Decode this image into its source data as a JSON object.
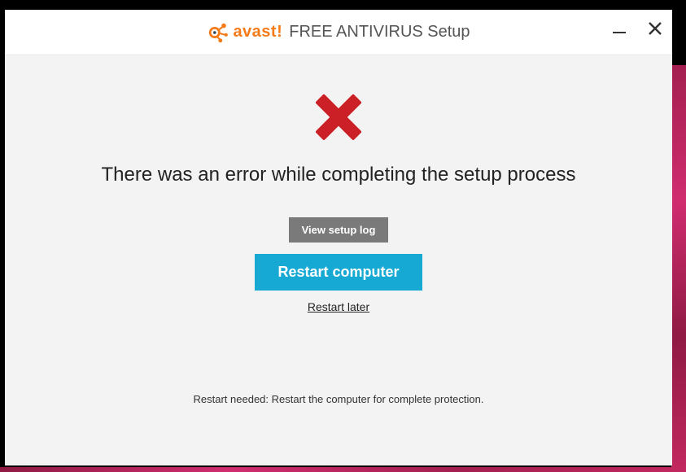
{
  "title": {
    "brand": "avast!",
    "product": "FREE ANTIVIRUS Setup"
  },
  "content": {
    "heading": "There was an error while completing the setup process",
    "view_log_label": "View setup log",
    "restart_button_label": "Restart computer",
    "restart_later_label": "Restart later",
    "footer_note": "Restart needed: Restart the computer for complete protection."
  },
  "icons": {
    "error": "error-x",
    "minimize": "minimize",
    "close": "close"
  },
  "colors": {
    "brand_orange": "#f57b19",
    "error_red": "#cb2026",
    "primary_blue": "#16a9d3"
  }
}
